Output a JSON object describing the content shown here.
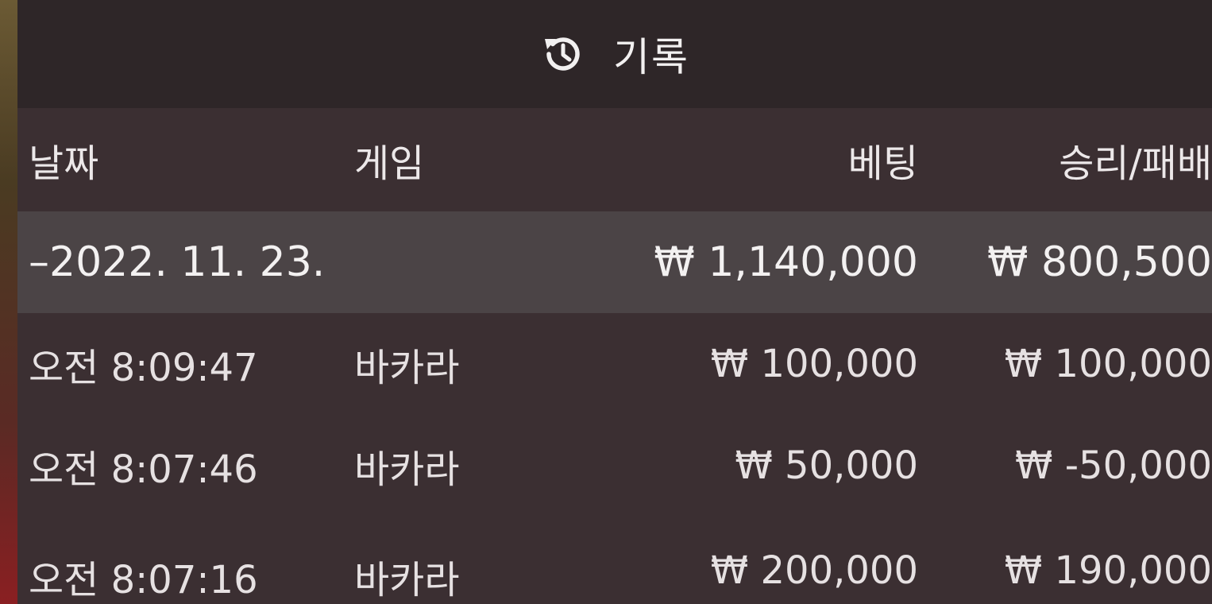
{
  "header": {
    "icon": "history-icon",
    "title": "기록"
  },
  "columns": {
    "date": "날짜",
    "game": "게임",
    "bet": "베팅",
    "win_loss": "승리/패배"
  },
  "summary": {
    "date": "–2022. 11. 23.",
    "bet": "₩ 1,140,000",
    "win_loss": "₩ 800,500"
  },
  "rows": [
    {
      "time": "오전 8:09:47",
      "game": "바카라",
      "bet": "₩ 100,000",
      "win_loss": "₩ 100,000"
    },
    {
      "time": "오전 8:07:46",
      "game": "바카라",
      "bet": "₩ 50,000",
      "win_loss": "₩ -50,000"
    },
    {
      "time": "오전 8:07:16",
      "game": "바카라",
      "bet": "₩ 200,000",
      "win_loss": "₩ 190,000"
    }
  ],
  "colors": {
    "header_bg": "#2e2628",
    "panel_bg": "#3b2f32",
    "summary_bg": "#4b4446",
    "text": "#e6e1e2"
  }
}
